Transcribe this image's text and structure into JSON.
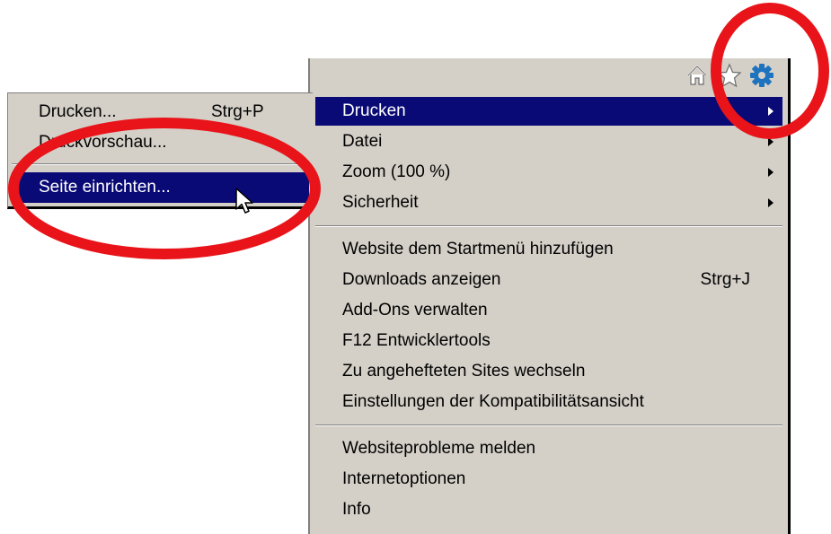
{
  "toolbar": {
    "icons": [
      "home-icon",
      "favorites-star-icon",
      "gear-tools-icon"
    ],
    "accent_color": "#1e73be"
  },
  "main_menu": {
    "groups": [
      [
        {
          "label": "Drucken",
          "submenu": true,
          "highlighted": true
        },
        {
          "label": "Datei",
          "submenu": true
        },
        {
          "label": "Zoom (100 %)",
          "submenu": true
        },
        {
          "label": "Sicherheit",
          "submenu": true
        }
      ],
      [
        {
          "label": "Website dem Startmenü hinzufügen"
        },
        {
          "label": "Downloads anzeigen",
          "shortcut": "Strg+J"
        },
        {
          "label": "Add-Ons verwalten"
        },
        {
          "label": "F12 Entwicklertools"
        },
        {
          "label": "Zu angehefteten Sites wechseln"
        },
        {
          "label": "Einstellungen der Kompatibilitätsansicht"
        }
      ],
      [
        {
          "label": "Websiteprobleme melden"
        },
        {
          "label": "Internetoptionen"
        },
        {
          "label": "Info"
        }
      ]
    ]
  },
  "sub_menu": {
    "items": [
      {
        "label": "Drucken...",
        "shortcut": "Strg+P"
      },
      {
        "label": "Druckvorschau..."
      },
      {
        "label": "Seite einrichten...",
        "highlighted": true
      }
    ]
  },
  "colors": {
    "menu_background": "#d4d0c8",
    "highlight": "#0a0a76",
    "annotation_red": "#e8141a"
  }
}
